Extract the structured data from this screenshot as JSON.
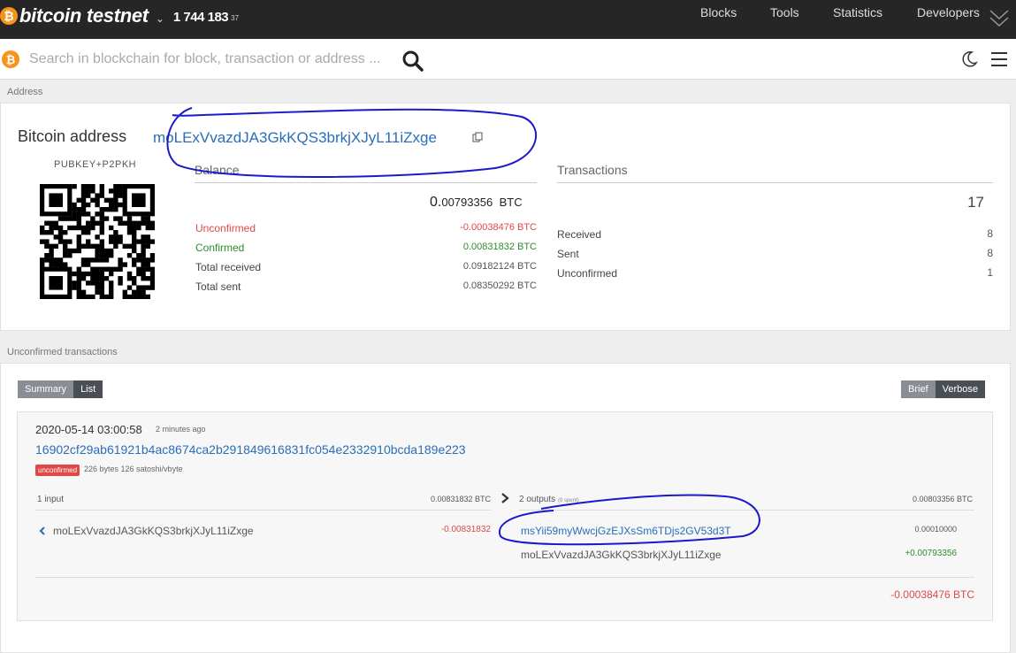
{
  "brand": {
    "name": "bitcoin testnet",
    "coin_symbol": "₿",
    "block_height": "1 744 183",
    "block_height_sup": "37"
  },
  "nav": {
    "blocks": "Blocks",
    "tools": "Tools",
    "statistics": "Statistics",
    "developers": "Developers"
  },
  "search": {
    "placeholder": "Search in blockchain for block, transaction or address ..."
  },
  "breadcrumb": {
    "address_section": "Address",
    "unconfirmed_section": "Unconfirmed transactions"
  },
  "address": {
    "title": "Bitcoin address",
    "value": "moLExVvazdJA3GkKQS3brkjXJyL11iZxge",
    "type": "PUBKEY+P2PKH"
  },
  "balance": {
    "header": "Balance",
    "total_main": "0.",
    "total_rest": "00793356",
    "total_unit": "BTC",
    "unconfirmed_label": "Unconfirmed",
    "unconfirmed_value": "-0.00038476 BTC",
    "confirmed_label": "Confirmed",
    "confirmed_value": "0.00831832 BTC",
    "received_label": "Total received",
    "received_value": "0.09182124 BTC",
    "sent_label": "Total sent",
    "sent_value": "0.08350292 BTC"
  },
  "transactions": {
    "header": "Transactions",
    "total": "17",
    "received_label": "Received",
    "received_value": "8",
    "sent_label": "Sent",
    "sent_value": "8",
    "unconfirmed_label": "Unconfirmed",
    "unconfirmed_value": "1"
  },
  "view_toggle": {
    "summary": "Summary",
    "list": "List",
    "brief": "Brief",
    "verbose": "Verbose"
  },
  "tx": {
    "date": "2020-05-14 03:00:58",
    "ago": "2 minutes ago",
    "hash": "16902cf29ab61921b4ac8674ca2b291849616831fc054e2332910bcda189e223",
    "badge": "unconfirmed",
    "meta": "226 bytes  126 satoshi/vbyte",
    "inputs_label": "1 input",
    "inputs_total": "0.00831832 BTC",
    "outputs_label": "2 outputs",
    "outputs_note": "(0 spent)",
    "outputs_total": "0.00803356 BTC",
    "input_addr": "moLExVvazdJA3GkKQS3brkjXJyL11iZxge",
    "input_value": "-0.00831832",
    "output1_addr": "msYii59myWwcjGzEJXsSm6TDjs2GV53d3T",
    "output1_value": "0.00010000",
    "output2_addr": "moLExVvazdJA3GkKQS3brkjXJyL11iZxge",
    "output2_value": "+0.00793356",
    "net": "-0.00038476 BTC"
  },
  "colors": {
    "accent": "#f7931a",
    "link": "#2a6eb8",
    "negative": "#e04848",
    "positive": "#2e8b2e",
    "annotation": "#1a1acc"
  },
  "icons": [
    "bitcoin-icon",
    "chevron-down-icon",
    "search-icon",
    "moon-icon",
    "menu-icon",
    "copy-icon",
    "qr-code",
    "arrow-right-icon",
    "arrow-left-icon"
  ]
}
